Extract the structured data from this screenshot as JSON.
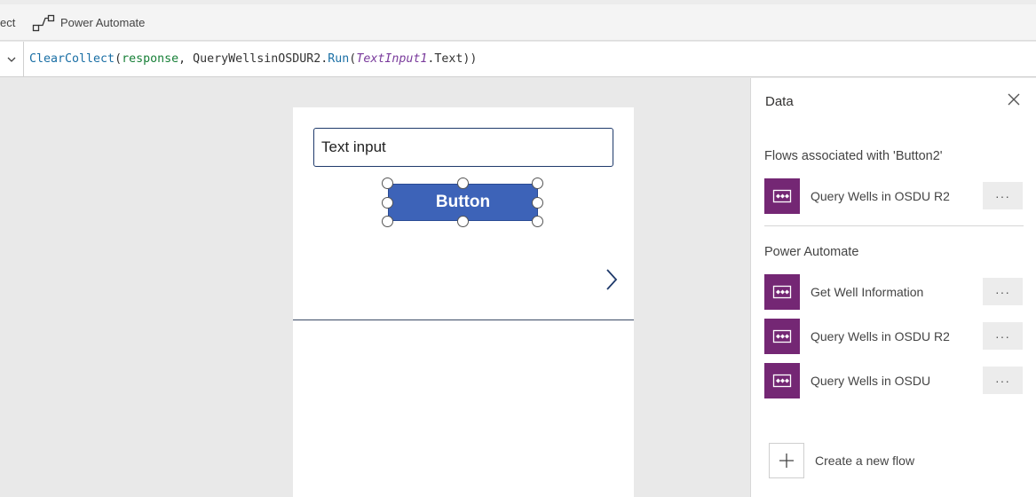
{
  "toolbar": {
    "cut_label": "ect",
    "power_automate_label": "Power Automate"
  },
  "formula": {
    "fn": "ClearCollect",
    "p1": "(",
    "arg1": "response",
    "p2": ", QueryWellsinOSDUR2.",
    "run": "Run",
    "p3": "(",
    "control": "TextInput1",
    "p4": ".Text))"
  },
  "canvas": {
    "text_input_value": "Text input",
    "button_label": "Button"
  },
  "panel": {
    "title": "Data",
    "associated_heading": "Flows associated with 'Button2'",
    "associated_flows": [
      {
        "name": "Query Wells in OSDU R2",
        "more": "···"
      }
    ],
    "power_automate_heading": "Power Automate",
    "flows": [
      {
        "name": "Get Well Information",
        "more": "···"
      },
      {
        "name": "Query Wells in OSDU R2",
        "more": "···"
      },
      {
        "name": "Query Wells in OSDU",
        "more": "···"
      }
    ],
    "create_label": "Create a new flow"
  },
  "colors": {
    "flow_icon": "#742774",
    "button": "#3d63b8"
  }
}
